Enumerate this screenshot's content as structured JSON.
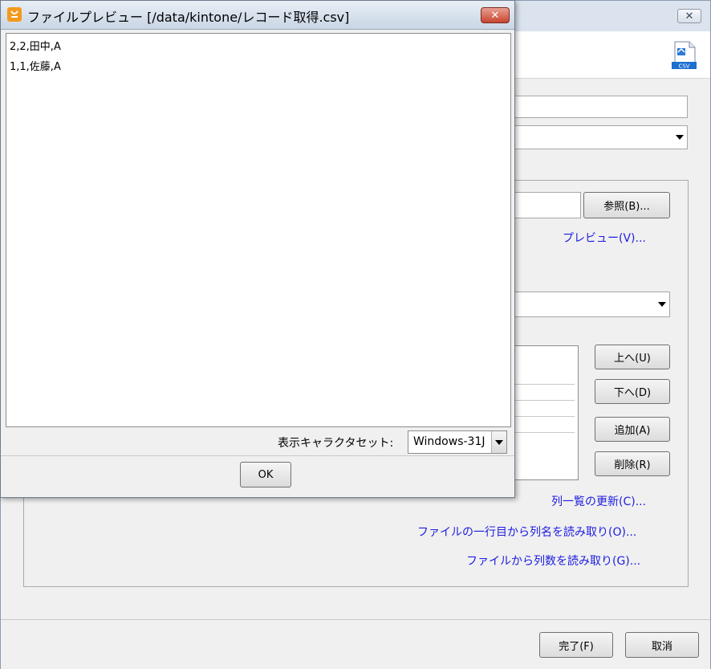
{
  "background_dialog": {
    "close_glyph": "✕",
    "csv_icon_label": "CSV",
    "buttons": {
      "browse": "参照(B)...",
      "up": "上へ(U)",
      "down": "下へ(D)",
      "add": "追加(A)",
      "delete": "削除(R)",
      "finish": "完了(F)",
      "cancel": "取消"
    },
    "links": {
      "preview": "プレビュー(V)...",
      "refresh_columns": "列一覧の更新(C)...",
      "read_names_first_row": "ファイルの一行目から列名を読み取り(O)...",
      "read_column_count": "ファイルから列数を読み取り(G)..."
    }
  },
  "preview_dialog": {
    "title": "ファイルプレビュー [/data/kintone/レコード取得.csv]",
    "close_glyph": "✕",
    "lines": [
      "2,2,田中,A",
      "1,1,佐藤,A"
    ],
    "charset_label": "表示キャラクタセット:",
    "charset_value": "Windows-31J",
    "ok_label": "OK"
  },
  "colors": {
    "link": "#1c1ce0",
    "title_gradient_top": "#e8eef5",
    "close_red": "#c9452f",
    "app_icon": "#f39a1e"
  }
}
